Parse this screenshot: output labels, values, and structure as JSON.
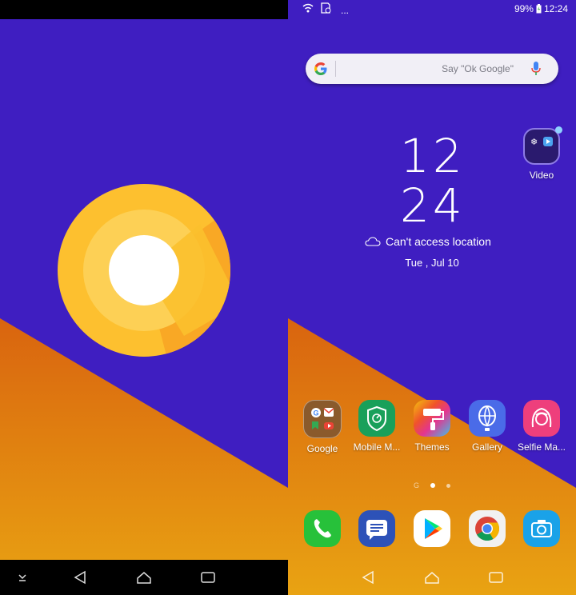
{
  "status_bar": {
    "battery": "99%",
    "time": "12:24",
    "more": "..."
  },
  "search": {
    "placeholder": "Say \"Ok Google\""
  },
  "clock": {
    "hour": "12",
    "minute": "24"
  },
  "weather": {
    "text": "Can't access location",
    "date": "Tue , Jul 10"
  },
  "folder": {
    "label": "Video"
  },
  "apps": [
    {
      "label": "Google",
      "icon": "google-folder-icon"
    },
    {
      "label": "Mobile M...",
      "icon": "mobile-manager-icon"
    },
    {
      "label": "Themes",
      "icon": "themes-icon"
    },
    {
      "label": "Gallery",
      "icon": "gallery-icon"
    },
    {
      "label": "Selfie Ma...",
      "icon": "selfie-master-icon"
    }
  ],
  "page_indicator": {
    "google_label": "G"
  },
  "dock": [
    {
      "icon": "phone-icon"
    },
    {
      "icon": "messages-icon"
    },
    {
      "icon": "play-store-icon"
    },
    {
      "icon": "chrome-icon"
    },
    {
      "icon": "camera-icon"
    }
  ],
  "colors": {
    "wallpaper_purple": "#3f1ec1",
    "wallpaper_orange": "#e07812",
    "android_o_yellow": "#fdc02f"
  }
}
